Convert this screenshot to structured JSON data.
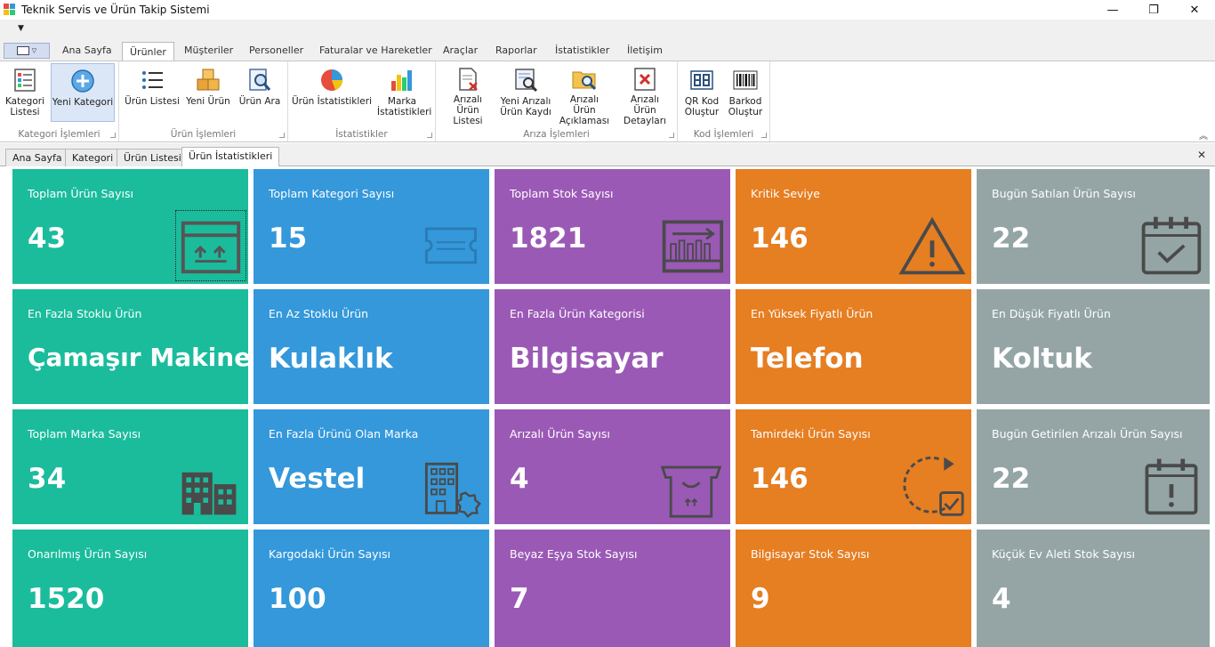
{
  "window": {
    "title": "Teknik Servis ve Ürün Takip Sistemi",
    "minimize": "—",
    "maximize": "❐",
    "close": "✕"
  },
  "ribbon": {
    "tabs": [
      {
        "label": "Ana Sayfa"
      },
      {
        "label": "Ürünler"
      },
      {
        "label": "Müşteriler"
      },
      {
        "label": "Personeller"
      },
      {
        "label": "Faturalar ve Hareketler"
      },
      {
        "label": "Araçlar"
      },
      {
        "label": "Raporlar"
      },
      {
        "label": "İstatistikler"
      },
      {
        "label": "İletişim"
      }
    ],
    "active_tab": "Ürünler",
    "groups": [
      {
        "label": "Kategori İşlemleri",
        "buttons": [
          {
            "label": "Kategori Listesi",
            "icon": "category-list-icon"
          },
          {
            "label": "Yeni Kategori",
            "icon": "add-circle-icon"
          }
        ]
      },
      {
        "label": "Ürün İşlemleri",
        "buttons": [
          {
            "label": "Ürün Listesi",
            "icon": "bullet-list-icon"
          },
          {
            "label": "Yeni Ürün",
            "icon": "boxes-icon"
          },
          {
            "label": "Ürün Ara",
            "icon": "search-document-icon"
          }
        ]
      },
      {
        "label": "İstatistikler",
        "buttons": [
          {
            "label": "Ürün İstatistikleri",
            "icon": "pie-chart-icon"
          },
          {
            "label": "Marka İstatistikleri",
            "icon": "bar-chart-icon"
          }
        ]
      },
      {
        "label": "Arıza İşlemleri",
        "buttons": [
          {
            "label": "Arızalı Ürün Listesi",
            "icon": "faulty-list-icon"
          },
          {
            "label": "Yeni Arızalı Ürün Kaydı",
            "icon": "repair-tool-icon"
          },
          {
            "label": "Arızalı Ürün Açıklaması",
            "icon": "folder-search-icon"
          },
          {
            "label": "Arızalı Ürün Detayları",
            "icon": "faulty-details-icon"
          }
        ]
      },
      {
        "label": "Kod İşlemleri",
        "buttons": [
          {
            "label": "QR Kod Oluştur",
            "icon": "qr-code-icon"
          },
          {
            "label": "Barkod Oluştur",
            "icon": "barcode-icon"
          }
        ]
      }
    ]
  },
  "doc_tabs": [
    {
      "label": "Ana Sayfa"
    },
    {
      "label": "Kategori"
    },
    {
      "label": "Ürün Listesi"
    },
    {
      "label": "Ürün İstatistikleri"
    }
  ],
  "active_doc_tab": "Ürün İstatistikleri",
  "colors": {
    "green": "#1abc9c",
    "blue": "#3498db",
    "purple": "#9b59b6",
    "orange": "#e67e22",
    "gray": "#95a5a6"
  },
  "tiles": [
    {
      "label": "Toplam Ürün Sayısı",
      "value": "43",
      "icon": "box-icon"
    },
    {
      "label": "Toplam Kategori Sayısı",
      "value": "15",
      "icon": "ticket-icon"
    },
    {
      "label": "Toplam Stok Sayısı",
      "value": "1821",
      "icon": "inventory-icon"
    },
    {
      "label": "Kritik Seviye",
      "value": "146",
      "icon": "warning-icon"
    },
    {
      "label": "Bugün Satılan Ürün Sayısı",
      "value": "22",
      "icon": "calendar-check-icon"
    },
    {
      "label": "En Fazla Stoklu Ürün",
      "value": "Çamaşır Makinesi",
      "icon": ""
    },
    {
      "label": "En Az Stoklu Ürün",
      "value": "Kulaklık",
      "icon": ""
    },
    {
      "label": "En Fazla Ürün Kategorisi",
      "value": "Bilgisayar",
      "icon": ""
    },
    {
      "label": "En Yüksek Fiyatlı Ürün",
      "value": "Telefon",
      "icon": ""
    },
    {
      "label": "En Düşük Fiyatlı Ürün",
      "value": "Koltuk",
      "icon": ""
    },
    {
      "label": "Toplam Marka Sayısı",
      "value": "34",
      "icon": "buildings-icon"
    },
    {
      "label": "En Fazla Ürünü Olan Marka",
      "value": "Vestel",
      "icon": "company-badge-icon"
    },
    {
      "label": "Arızalı Ürün Sayısı",
      "value": "4",
      "icon": "broken-box-icon"
    },
    {
      "label": "Tamirdeki Ürün Sayısı",
      "value": "146",
      "icon": "repair-cycle-icon"
    },
    {
      "label": "Bugün Getirilen Arızalı Ürün Sayısı",
      "value": "22",
      "icon": "calendar-alert-icon"
    },
    {
      "label": "Onarılmış Ürün Sayısı",
      "value": "1520",
      "icon": ""
    },
    {
      "label": "Kargodaki Ürün Sayısı",
      "value": "100",
      "icon": ""
    },
    {
      "label": "Beyaz Eşya Stok Sayısı",
      "value": "7",
      "icon": ""
    },
    {
      "label": "Bilgisayar Stok Sayısı",
      "value": "9",
      "icon": ""
    },
    {
      "label": "Küçük Ev Aleti Stok Sayısı",
      "value": "4",
      "icon": ""
    }
  ]
}
